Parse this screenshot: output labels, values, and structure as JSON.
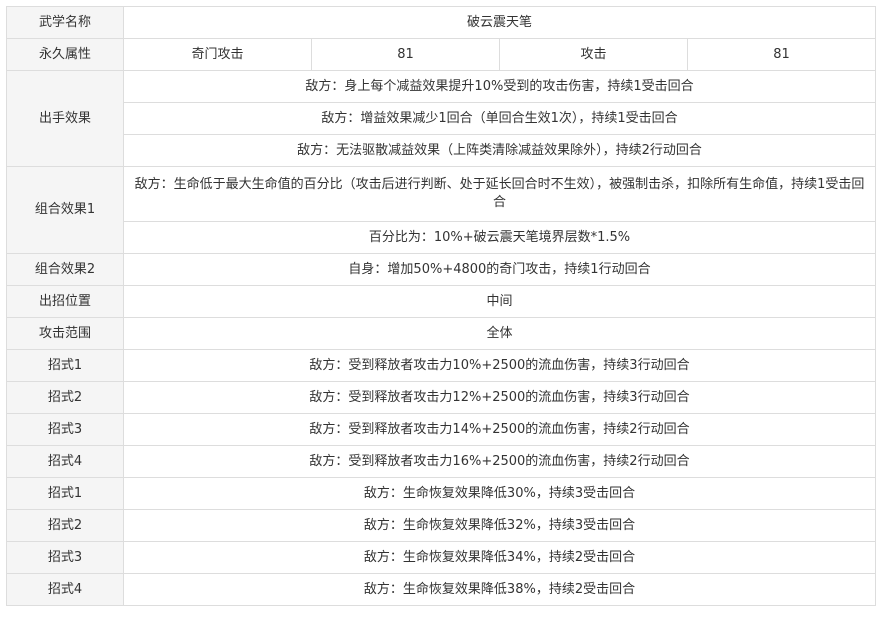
{
  "table": {
    "name_label": "武学名称",
    "name_value": "破云震天笔",
    "perm_label": "永久属性",
    "perm_values": [
      "奇门攻击",
      "81",
      "攻击",
      "81"
    ],
    "effect_label": "出手效果",
    "effects": [
      "敌方：身上每个减益效果提升10%受到的攻击伤害，持续1受击回合",
      "敌方：增益效果减少1回合（单回合生效1次），持续1受击回合",
      "敌方：无法驱散减益效果（上阵类清除减益效果除外），持续2行动回合"
    ],
    "combo1_label": "组合效果1",
    "combo1_values": [
      "敌方：生命低于最大生命值的百分比（攻击后进行判断、处于延长回合时不生效），被强制击杀，扣除所有生命值，持续1受击回合",
      "百分比为：10%+破云震天笔境界层数*1.5%"
    ],
    "combo2_label": "组合效果2",
    "combo2_value": "自身：增加50%+4800的奇门攻击，持续1行动回合",
    "position_label": "出招位置",
    "position_value": "中间",
    "range_label": "攻击范围",
    "range_value": "全体",
    "moves": [
      {
        "label": "招式1",
        "value": "敌方：受到释放者攻击力10%+2500的流血伤害，持续3行动回合"
      },
      {
        "label": "招式2",
        "value": "敌方：受到释放者攻击力12%+2500的流血伤害，持续3行动回合"
      },
      {
        "label": "招式3",
        "value": "敌方：受到释放者攻击力14%+2500的流血伤害，持续2行动回合"
      },
      {
        "label": "招式4",
        "value": "敌方：受到释放者攻击力16%+2500的流血伤害，持续2行动回合"
      },
      {
        "label": "招式1",
        "value": "敌方：生命恢复效果降低30%，持续3受击回合"
      },
      {
        "label": "招式2",
        "value": "敌方：生命恢复效果降低32%，持续3受击回合"
      },
      {
        "label": "招式3",
        "value": "敌方：生命恢复效果降低34%，持续2受击回合"
      },
      {
        "label": "招式4",
        "value": "敌方：生命恢复效果降低38%，持续2受击回合"
      }
    ]
  }
}
